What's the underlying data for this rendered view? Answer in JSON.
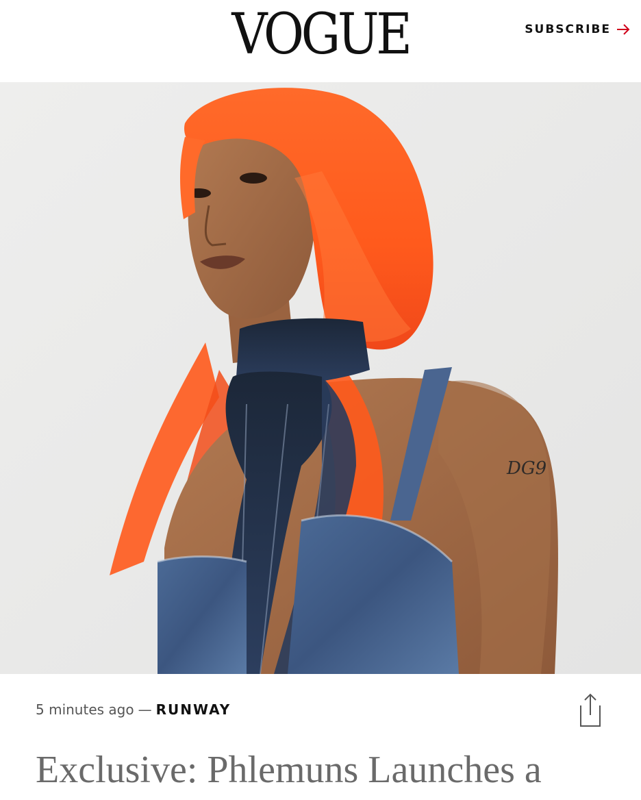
{
  "header": {
    "logo_text": "VOGUE",
    "subscribe_label": "SUBSCRIBE",
    "subscribe_icon": "arrow-right-icon",
    "accent_color": "#d0021b"
  },
  "hero": {
    "image": "model-portrait-photo"
  },
  "article": {
    "timestamp": "5 minutes ago",
    "separator": "—",
    "section": "RUNWAY",
    "share_icon": "share-icon",
    "headline": "Exclusive: Phlemuns Launches a"
  }
}
